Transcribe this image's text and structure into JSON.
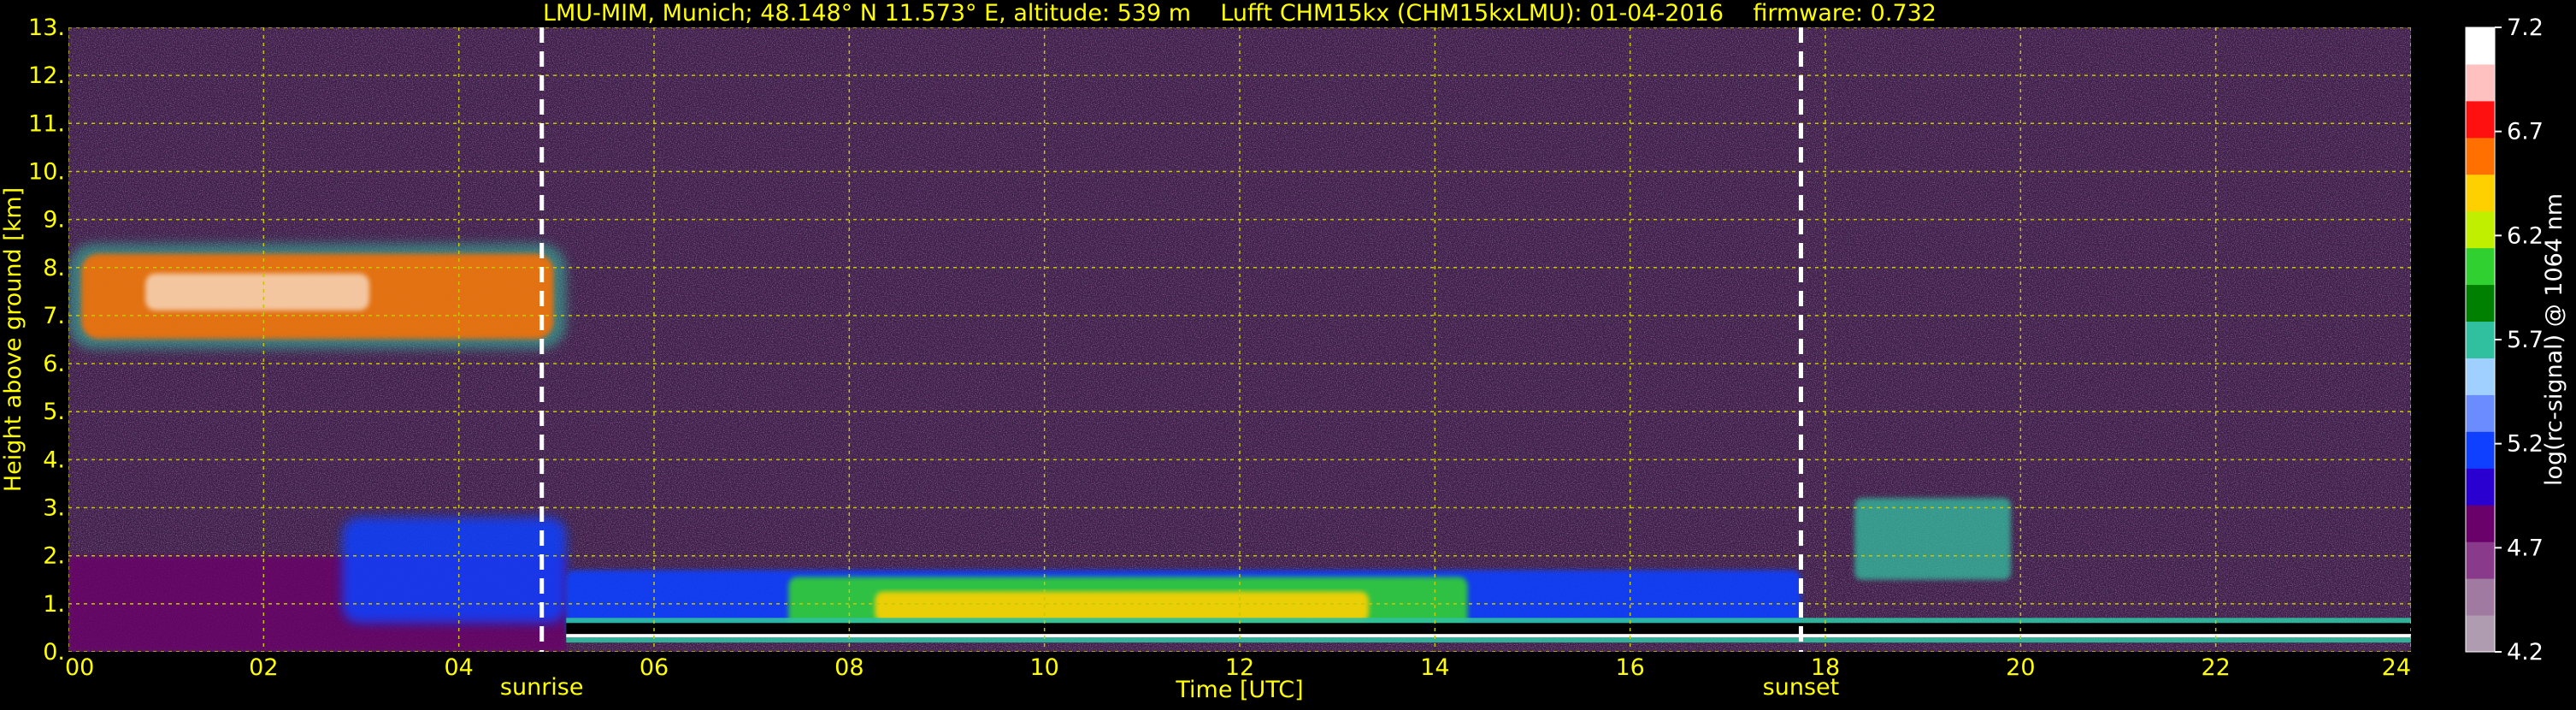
{
  "chart_data": {
    "type": "heatmap",
    "title": "LMU-MIM, Munich; 48.148° N 11.573° E, altitude: 539 m    Lufft CHM15kx (CHM15kxLMU): 01-04-2016    firmware: 0.732",
    "xlabel": "Time [UTC]",
    "ylabel": "Height above ground [km]",
    "colorbar_label": "log(rc-signal) @ 1064 nm",
    "xlim": [
      0,
      24
    ],
    "ylim": [
      0,
      13
    ],
    "x_ticks": [
      "00",
      "02",
      "04",
      "06",
      "08",
      "10",
      "12",
      "14",
      "16",
      "18",
      "20",
      "22",
      "24"
    ],
    "x_tick_values": [
      0,
      2,
      4,
      6,
      8,
      10,
      12,
      14,
      16,
      18,
      20,
      22,
      24
    ],
    "y_ticks": [
      "0.",
      "1.",
      "2.",
      "3.",
      "4.",
      "5.",
      "6.",
      "7.",
      "8.",
      "9.",
      "10.",
      "11.",
      "12.",
      "13."
    ],
    "y_tick_values": [
      0,
      1,
      2,
      3,
      4,
      5,
      6,
      7,
      8,
      9,
      10,
      11,
      12,
      13
    ],
    "colorbar_ticks": [
      "4.2",
      "4.7",
      "5.2",
      "5.7",
      "6.2",
      "6.7",
      "7.2"
    ],
    "colorbar_tick_values": [
      4.2,
      4.7,
      5.2,
      5.7,
      6.2,
      6.7,
      7.2
    ],
    "colorbar_range": [
      4.2,
      7.2
    ],
    "grid": true,
    "annotations": [
      {
        "label": "sunrise",
        "x": 4.85
      },
      {
        "label": "sunset",
        "x": 17.75
      }
    ],
    "features": [
      {
        "kind": "cirrus-cloud",
        "x_range": [
          0,
          5.1
        ],
        "y_range": [
          6.3,
          8.5
        ],
        "level": 6.7
      },
      {
        "kind": "residual-aerosol-layer",
        "x_range": [
          0,
          5.1
        ],
        "y_range": [
          0,
          2.0
        ],
        "level": 5.2
      },
      {
        "kind": "boundary-layer",
        "x_range": [
          5.1,
          17.75
        ],
        "y_range": [
          0.3,
          1.7
        ],
        "level": 6.4
      },
      {
        "kind": "low-cloud-base",
        "x_range": [
          5.1,
          24
        ],
        "y_range": [
          0.3,
          0.6
        ],
        "level": 7.2
      },
      {
        "kind": "evening-cloud-tops",
        "x_range": [
          18.3,
          19.9
        ],
        "y_range": [
          1.5,
          3.2
        ],
        "level": 5.7
      }
    ],
    "colors": {
      "background": "#000000",
      "text": "#ffff00",
      "grid": "#c8c800",
      "colorbar_text": "#ffffff",
      "colormap": [
        "#b09cb0",
        "#a07aa0",
        "#8a3a8a",
        "#6a006a",
        "#2a00d0",
        "#1040ff",
        "#6a8cff",
        "#a0d0ff",
        "#30c0a0",
        "#008000",
        "#30d030",
        "#c0f000",
        "#ffd000",
        "#ff7000",
        "#ff1010",
        "#ffc0c0",
        "#ffffff"
      ]
    }
  }
}
